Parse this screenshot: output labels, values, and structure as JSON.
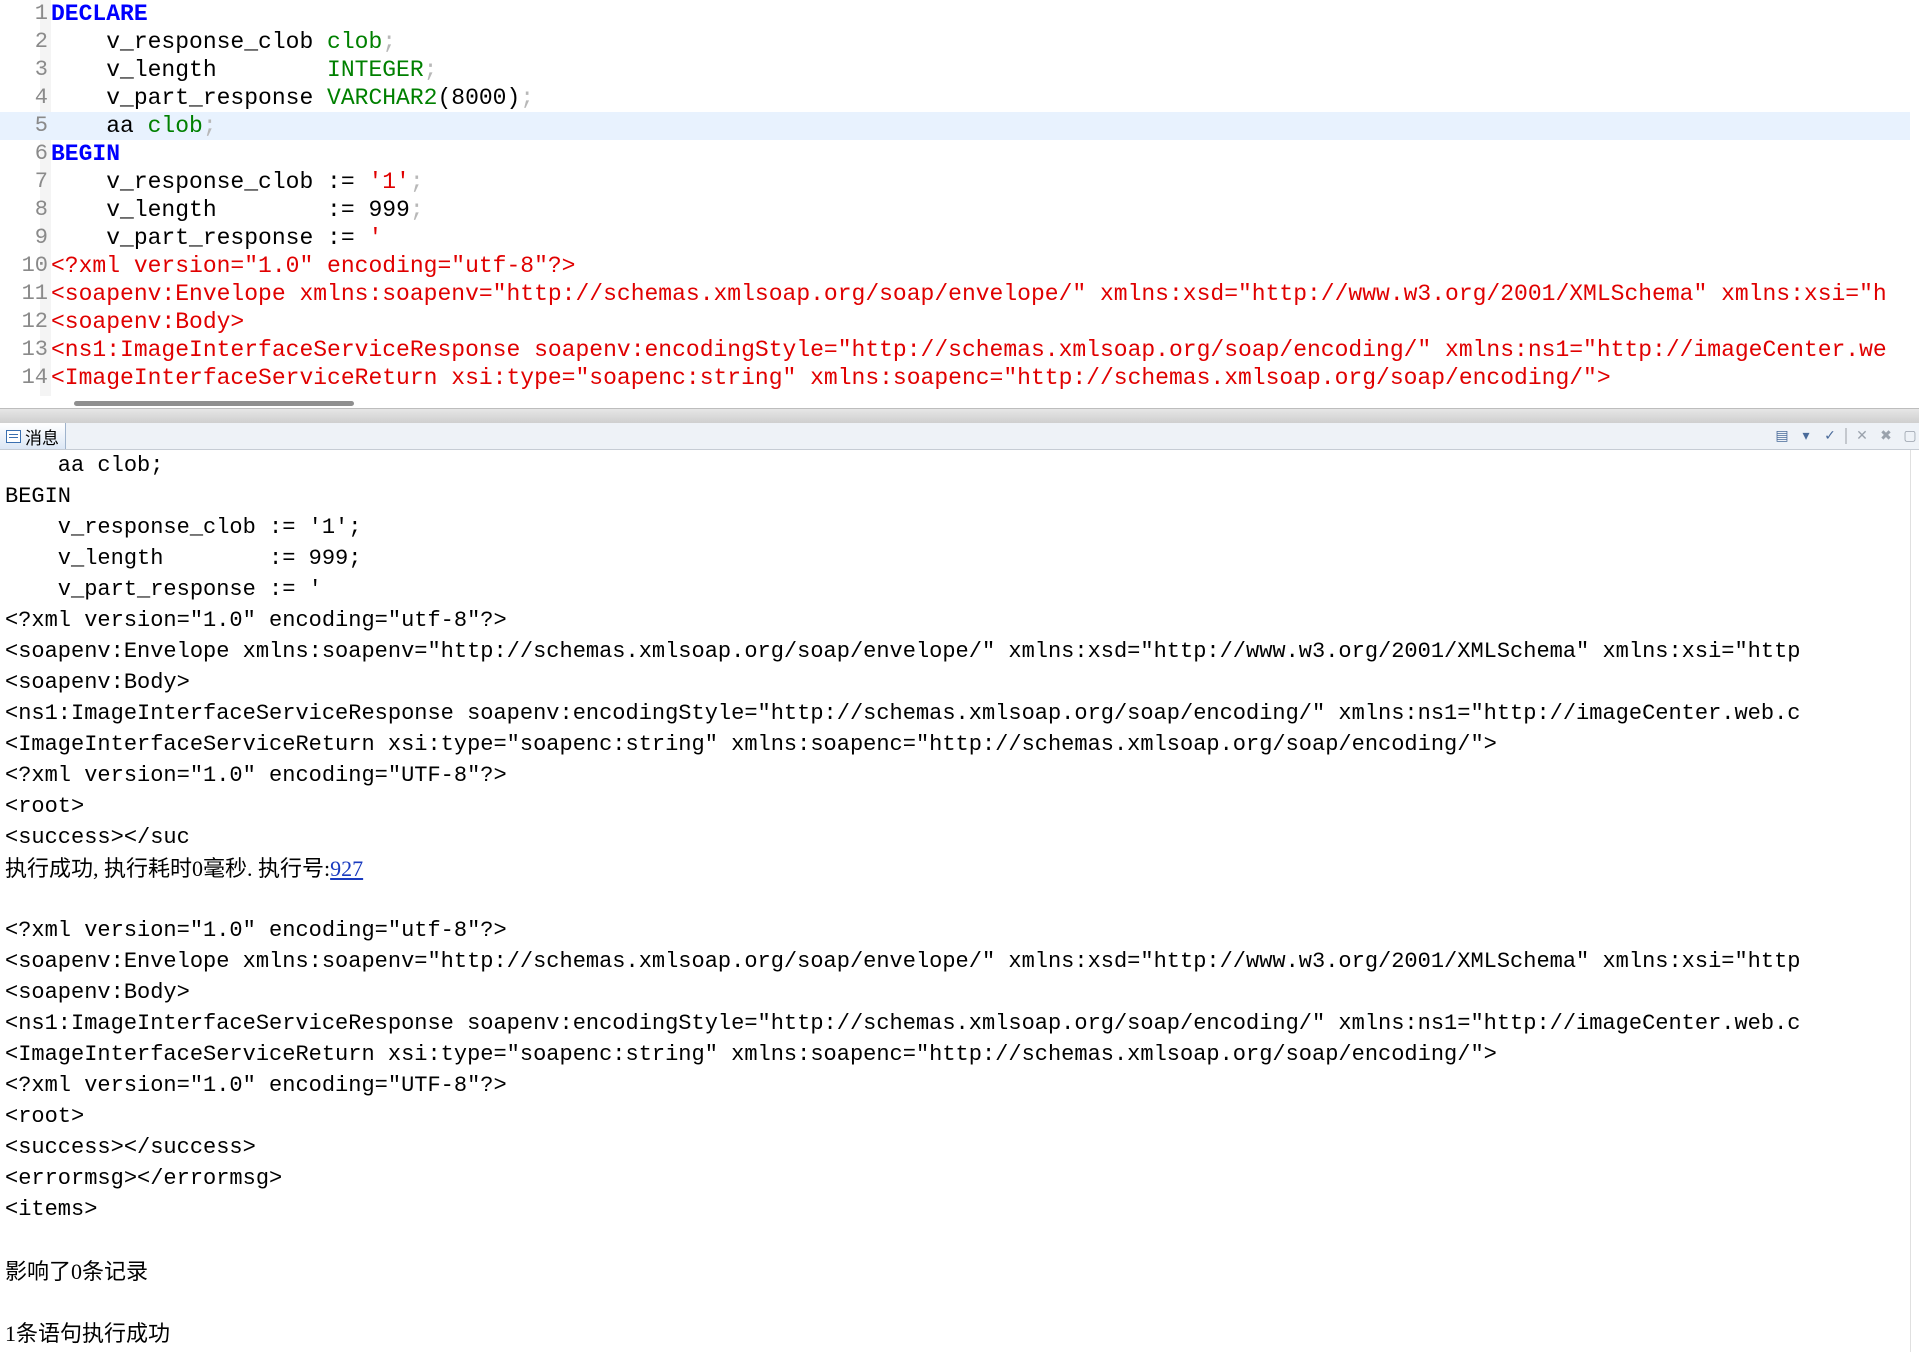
{
  "editor": {
    "lines": [
      {
        "num": "1",
        "segs": [
          {
            "t": "DECLARE",
            "c": "kw"
          }
        ]
      },
      {
        "num": "2",
        "segs": [
          {
            "t": "    v_response_clob ",
            "c": ""
          },
          {
            "t": "clob",
            "c": "ty"
          },
          {
            "t": ";",
            "c": "pn"
          }
        ]
      },
      {
        "num": "3",
        "segs": [
          {
            "t": "    v_length        ",
            "c": ""
          },
          {
            "t": "INTEGER",
            "c": "ty"
          },
          {
            "t": ";",
            "c": "pn"
          }
        ]
      },
      {
        "num": "4",
        "segs": [
          {
            "t": "    v_part_response ",
            "c": ""
          },
          {
            "t": "VARCHAR2",
            "c": "ty"
          },
          {
            "t": "(8000)",
            "c": ""
          },
          {
            "t": ";",
            "c": "pn"
          }
        ]
      },
      {
        "num": "5",
        "segs": [
          {
            "t": "    aa ",
            "c": ""
          },
          {
            "t": "clob",
            "c": "ty"
          },
          {
            "t": ";",
            "c": "pn"
          }
        ],
        "highlight": true
      },
      {
        "num": "6",
        "segs": [
          {
            "t": "BEGIN",
            "c": "kw"
          }
        ]
      },
      {
        "num": "7",
        "segs": [
          {
            "t": "    v_response_clob := ",
            "c": ""
          },
          {
            "t": "'1'",
            "c": "st"
          },
          {
            "t": ";",
            "c": "pn"
          }
        ]
      },
      {
        "num": "8",
        "segs": [
          {
            "t": "    v_length        := 999",
            "c": ""
          },
          {
            "t": ";",
            "c": "pn"
          }
        ]
      },
      {
        "num": "9",
        "segs": [
          {
            "t": "    v_part_response := ",
            "c": ""
          },
          {
            "t": "'",
            "c": "st"
          }
        ]
      },
      {
        "num": "10",
        "segs": [
          {
            "t": "<?xml version=\"1.0\" encoding=\"utf-8\"?>",
            "c": "xl"
          }
        ]
      },
      {
        "num": "11",
        "segs": [
          {
            "t": "<soapenv:Envelope xmlns:soapenv=\"http://schemas.xmlsoap.org/soap/envelope/\" xmlns:xsd=\"http://www.w3.org/2001/XMLSchema\" xmlns:xsi=\"h",
            "c": "xl"
          }
        ]
      },
      {
        "num": "12",
        "segs": [
          {
            "t": "<soapenv:Body>",
            "c": "xl"
          }
        ]
      },
      {
        "num": "13",
        "segs": [
          {
            "t": "<ns1:ImageInterfaceServiceResponse soapenv:encodingStyle=\"http://schemas.xmlsoap.org/soap/encoding/\" xmlns:ns1=\"http://imageCenter.we",
            "c": "xl"
          }
        ]
      },
      {
        "num": "14",
        "segs": [
          {
            "t": "<ImageInterfaceServiceReturn xsi:type=\"soapenc:string\" xmlns:soapenc=\"http://schemas.xmlsoap.org/soap/encoding/\">",
            "c": "xl"
          }
        ]
      }
    ]
  },
  "panel": {
    "tab_label": "消息",
    "tab_icon": "message-list-icon",
    "toolbar_icons": [
      "view-menu-icon",
      "dropdown-arrow-icon",
      "pin-icon",
      "remove-icon",
      "remove-all-icon",
      "maximize-icon"
    ]
  },
  "messages": [
    {
      "t": "    aa clob;",
      "mono": true
    },
    {
      "t": "BEGIN",
      "mono": true
    },
    {
      "t": "    v_response_clob := '1';",
      "mono": true
    },
    {
      "t": "    v_length        := 999;",
      "mono": true
    },
    {
      "t": "    v_part_response := '",
      "mono": true
    },
    {
      "t": "<?xml version=\"1.0\" encoding=\"utf-8\"?>",
      "mono": true
    },
    {
      "t": "<soapenv:Envelope xmlns:soapenv=\"http://schemas.xmlsoap.org/soap/envelope/\" xmlns:xsd=\"http://www.w3.org/2001/XMLSchema\" xmlns:xsi=\"http",
      "mono": true
    },
    {
      "t": "<soapenv:Body>",
      "mono": true
    },
    {
      "t": "<ns1:ImageInterfaceServiceResponse soapenv:encodingStyle=\"http://schemas.xmlsoap.org/soap/encoding/\" xmlns:ns1=\"http://imageCenter.web.c",
      "mono": true
    },
    {
      "t": "<ImageInterfaceServiceReturn xsi:type=\"soapenc:string\" xmlns:soapenc=\"http://schemas.xmlsoap.org/soap/encoding/\">",
      "mono": true
    },
    {
      "t": "<?xml version=\"1.0\" encoding=\"UTF-8\"?>",
      "mono": true
    },
    {
      "t": "<root>",
      "mono": true
    },
    {
      "t": "<success></suc",
      "mono": true
    },
    {
      "t": "执行成功, 执行耗时0毫秒. 执行号:",
      "mono": false,
      "link": "927"
    },
    {
      "t": "",
      "mono": true
    },
    {
      "t": "<?xml version=\"1.0\" encoding=\"utf-8\"?>",
      "mono": true
    },
    {
      "t": "<soapenv:Envelope xmlns:soapenv=\"http://schemas.xmlsoap.org/soap/envelope/\" xmlns:xsd=\"http://www.w3.org/2001/XMLSchema\" xmlns:xsi=\"http",
      "mono": true
    },
    {
      "t": "<soapenv:Body>",
      "mono": true
    },
    {
      "t": "<ns1:ImageInterfaceServiceResponse soapenv:encodingStyle=\"http://schemas.xmlsoap.org/soap/encoding/\" xmlns:ns1=\"http://imageCenter.web.c",
      "mono": true
    },
    {
      "t": "<ImageInterfaceServiceReturn xsi:type=\"soapenc:string\" xmlns:soapenc=\"http://schemas.xmlsoap.org/soap/encoding/\">",
      "mono": true
    },
    {
      "t": "<?xml version=\"1.0\" encoding=\"UTF-8\"?>",
      "mono": true
    },
    {
      "t": "<root>",
      "mono": true
    },
    {
      "t": "<success></success>",
      "mono": true
    },
    {
      "t": "<errormsg></errormsg>",
      "mono": true
    },
    {
      "t": "<items>",
      "mono": true
    },
    {
      "t": "",
      "mono": true
    },
    {
      "t": "影响了0条记录",
      "mono": false
    },
    {
      "t": "",
      "mono": true
    },
    {
      "t": "1条语句执行成功",
      "mono": false
    }
  ]
}
